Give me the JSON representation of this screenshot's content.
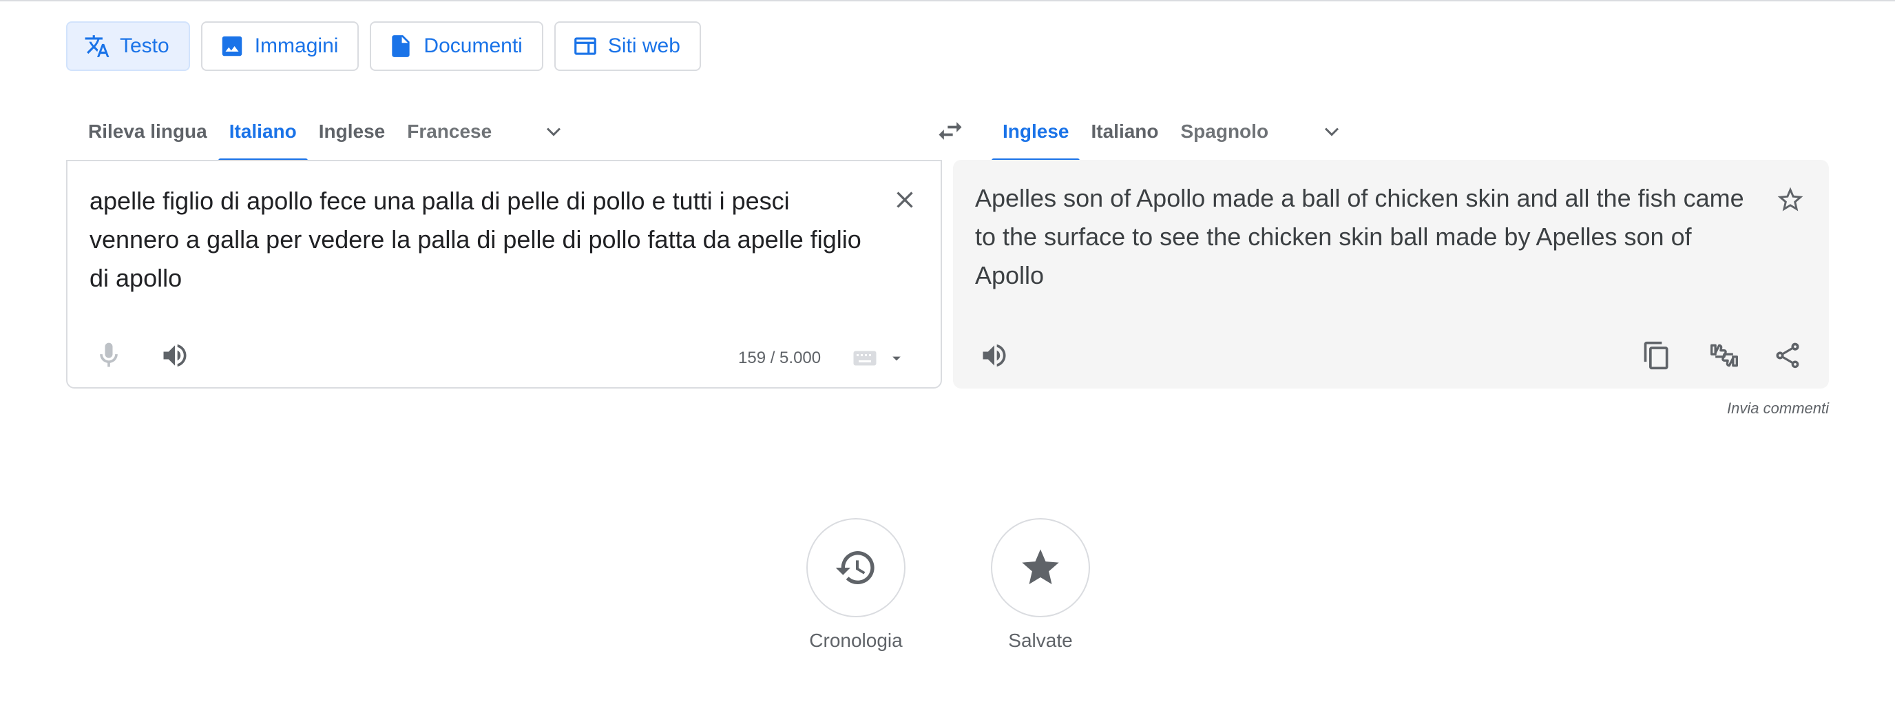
{
  "modes": [
    {
      "label": "Testo",
      "icon": "translate-icon",
      "active": true
    },
    {
      "label": "Immagini",
      "icon": "image-icon",
      "active": false
    },
    {
      "label": "Documenti",
      "icon": "document-icon",
      "active": false
    },
    {
      "label": "Siti web",
      "icon": "website-icon",
      "active": false
    }
  ],
  "source_languages": {
    "items": [
      "Rileva lingua",
      "Italiano",
      "Inglese",
      "Francese"
    ],
    "active": "Italiano",
    "more_icon": "chevron-down-icon"
  },
  "target_languages": {
    "items": [
      "Inglese",
      "Italiano",
      "Spagnolo"
    ],
    "active": "Inglese",
    "more_icon": "chevron-down-icon"
  },
  "swap_icon": "swap-icon",
  "source": {
    "text": "apelle figlio di apollo fece una palla di pelle di pollo e tutti i pesci vennero a galla per vedere la palla di pelle di pollo fatta da apelle figlio di apollo",
    "char_count": "159 / 5.000",
    "icons": [
      "close-icon",
      "microphone-icon",
      "speaker-icon",
      "keyboard-icon",
      "dropdown-icon"
    ]
  },
  "target": {
    "text": "Apelles son of Apollo made a ball of chicken skin and all the fish came to the surface to see the chicken skin ball made by Apelles son of Apollo",
    "icons": [
      "star-outline-icon",
      "speaker-icon",
      "copy-icon",
      "rate-icon",
      "share-icon"
    ]
  },
  "feedback_label": "Invia commenti",
  "bottom": [
    {
      "label": "Cronologia",
      "icon": "history-icon"
    },
    {
      "label": "Salvate",
      "icon": "star-icon"
    }
  ],
  "colors": {
    "accent": "#1a73e8",
    "active_bg": "#e8f0fe",
    "border": "#dadce0",
    "target_panel_bg": "#f5f5f5",
    "icon_gray": "#5f6368"
  }
}
